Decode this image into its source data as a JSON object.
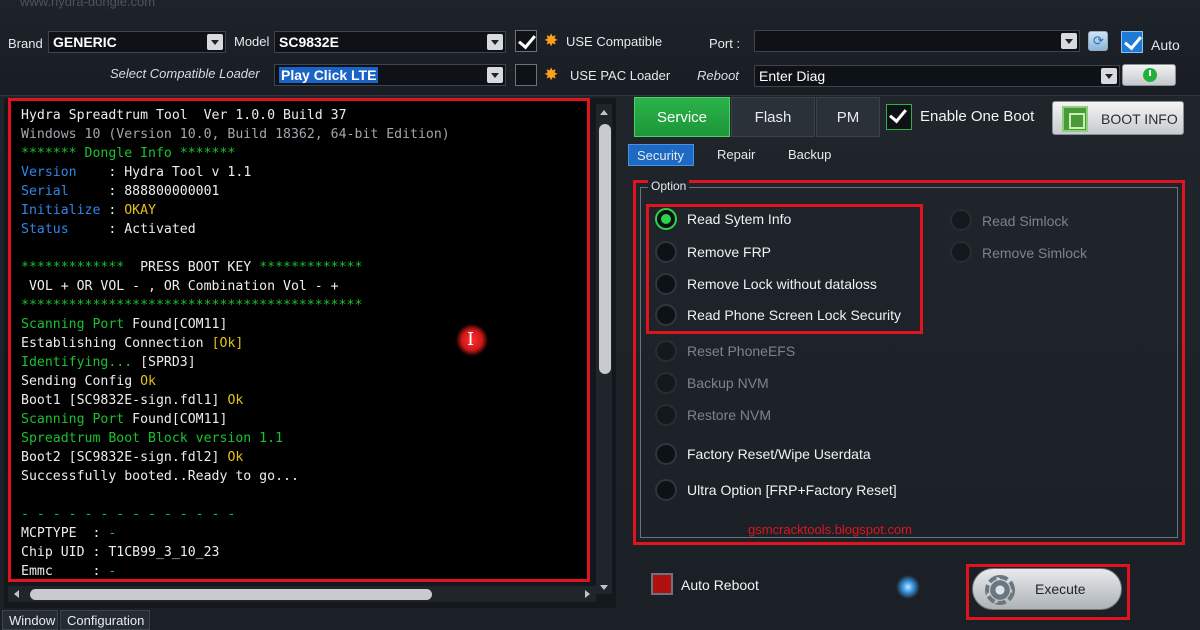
{
  "watermark_url": "www.hydra-dongle.com",
  "top": {
    "brand_label": "Brand",
    "brand_value": "GENERIC",
    "model_label": "Model",
    "model_value": "SC9832E",
    "use_compatible_label": "USE Compatible",
    "use_compatible_checked": true,
    "select_loader_label": "Select Compatible Loader",
    "loader_value": "Play Click LTE",
    "use_pac_label": "USE PAC Loader",
    "use_pac_checked": false,
    "port_label": "Port :",
    "port_value": "",
    "auto_label": "Auto",
    "auto_checked": true,
    "reboot_label": "Reboot",
    "reboot_value": "Enter Diag"
  },
  "console": {
    "lines": [
      [
        {
          "t": "Hydra Spreadtrum Tool  Ver 1.0.0 Build 37",
          "c": "white"
        }
      ],
      [
        {
          "t": "Windows 10 (Version 10.0, Build 18362, 64-bit Edition)",
          "c": "gray"
        }
      ],
      [
        {
          "t": "******* Dongle Info *******",
          "c": "green"
        }
      ],
      [
        {
          "t": "Version    ",
          "c": "blue"
        },
        {
          "t": ": Hydra Tool v 1.1",
          "c": "white"
        }
      ],
      [
        {
          "t": "Serial     ",
          "c": "blue"
        },
        {
          "t": ": 888800000001",
          "c": "white"
        }
      ],
      [
        {
          "t": "Initialize ",
          "c": "blue"
        },
        {
          "t": ": ",
          "c": "white"
        },
        {
          "t": "OKAY",
          "c": "yellow"
        }
      ],
      [
        {
          "t": "Status     ",
          "c": "blue"
        },
        {
          "t": ": Activated",
          "c": "white"
        }
      ],
      [
        {
          "t": "",
          "c": "white"
        }
      ],
      [
        {
          "t": "*************",
          "c": "green"
        },
        {
          "t": "  PRESS BOOT KEY ",
          "c": "white"
        },
        {
          "t": "*************",
          "c": "green"
        }
      ],
      [
        {
          "t": " VOL + OR VOL - , OR Combination Vol - +",
          "c": "white"
        }
      ],
      [
        {
          "t": "*******************************************",
          "c": "green"
        }
      ],
      [
        {
          "t": "Scanning Port ",
          "c": "green"
        },
        {
          "t": "Found[COM11]",
          "c": "white"
        }
      ],
      [
        {
          "t": "Establishing Connection ",
          "c": "white"
        },
        {
          "t": "[Ok]",
          "c": "yellow"
        }
      ],
      [
        {
          "t": "Identifying... ",
          "c": "green"
        },
        {
          "t": "[SPRD3]",
          "c": "white"
        }
      ],
      [
        {
          "t": "Sending Config ",
          "c": "white"
        },
        {
          "t": "Ok",
          "c": "yellow"
        }
      ],
      [
        {
          "t": "Boot1 [SC9832E-sign.fdl1] ",
          "c": "white"
        },
        {
          "t": "Ok",
          "c": "yellow"
        }
      ],
      [
        {
          "t": "Scanning Port ",
          "c": "green"
        },
        {
          "t": "Found[COM11]",
          "c": "white"
        }
      ],
      [
        {
          "t": "Spreadtrum Boot Block version 1.1",
          "c": "green"
        }
      ],
      [
        {
          "t": "Boot2 [SC9832E-sign.fdl2] ",
          "c": "white"
        },
        {
          "t": "Ok",
          "c": "yellow"
        }
      ],
      [
        {
          "t": "Successfully booted..Ready to go...",
          "c": "white"
        }
      ],
      [
        {
          "t": "",
          "c": "white"
        }
      ],
      [
        {
          "t": "- - - - - - - - - - - - - -",
          "c": "green"
        }
      ],
      [
        {
          "t": "MCPTYPE  : ",
          "c": "white"
        },
        {
          "t": "-",
          "c": "green"
        }
      ],
      [
        {
          "t": "Chip UID : T1CB99_3_10_23",
          "c": "white"
        }
      ],
      [
        {
          "t": "Emmc     : ",
          "c": "white"
        },
        {
          "t": "-",
          "c": "green"
        }
      ]
    ]
  },
  "bottom_tabs": [
    "Window",
    "Configuration"
  ],
  "main_tabs": [
    "Service",
    "Flash",
    "PM"
  ],
  "enable_one_boot_label": "Enable One Boot",
  "enable_one_boot_checked": true,
  "boot_info_label": "BOOT INFO",
  "sub_tabs": [
    "Security",
    "Repair",
    "Backup"
  ],
  "option_legend": "Option",
  "options_left": [
    {
      "label": "Read Sytem Info",
      "selected": true,
      "enabled": true
    },
    {
      "label": "Remove FRP",
      "selected": false,
      "enabled": true
    },
    {
      "label": "Remove Lock without dataloss",
      "selected": false,
      "enabled": true
    },
    {
      "label": "Read Phone Screen Lock Security",
      "selected": false,
      "enabled": true
    },
    {
      "label": "Reset PhoneEFS",
      "selected": false,
      "enabled": false
    },
    {
      "label": "Backup NVM",
      "selected": false,
      "enabled": false
    },
    {
      "label": "Restore NVM",
      "selected": false,
      "enabled": false
    },
    {
      "label": "Factory Reset/Wipe Userdata",
      "selected": false,
      "enabled": true
    },
    {
      "label": "Ultra Option [FRP+Factory Reset]",
      "selected": false,
      "enabled": true
    }
  ],
  "options_right": [
    {
      "label": "Read Simlock",
      "selected": false,
      "enabled": false
    },
    {
      "label": "Remove Simlock",
      "selected": false,
      "enabled": false
    }
  ],
  "watermark_blog": "gsmcracktools.blogspot.com",
  "auto_reboot_label": "Auto Reboot",
  "execute_label": "Execute",
  "colors": {
    "accent_green": "#2bb34a",
    "highlight_red": "#e0141e",
    "select_blue": "#1b64c7"
  }
}
